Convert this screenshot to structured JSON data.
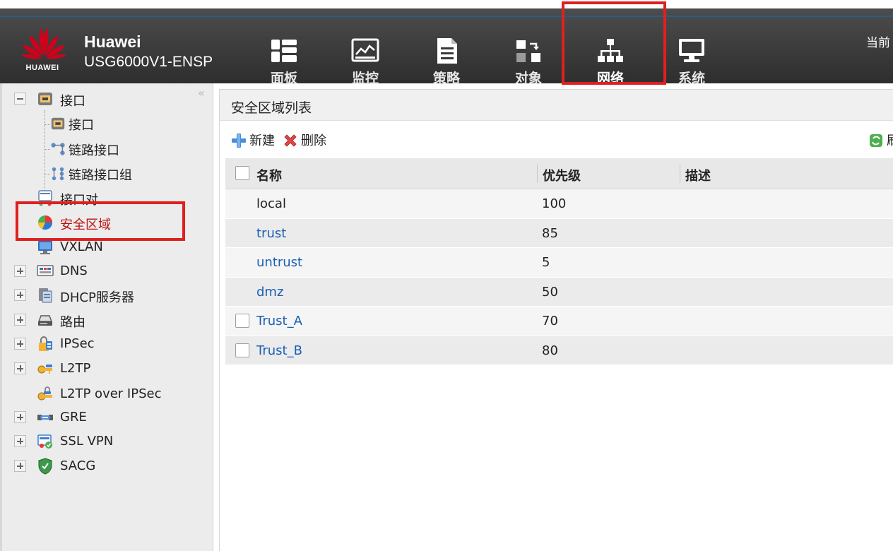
{
  "header": {
    "logo_text": "HUAWEI",
    "brand": "Huawei",
    "model": "USG6000V1-ENSP",
    "current_user_prefix": "当前",
    "nav": [
      {
        "id": "dashboard",
        "label": "面板",
        "icon": "dashboard-icon"
      },
      {
        "id": "monitor",
        "label": "监控",
        "icon": "monitor-icon"
      },
      {
        "id": "policy",
        "label": "策略",
        "icon": "policy-icon"
      },
      {
        "id": "object",
        "label": "对象",
        "icon": "object-icon"
      },
      {
        "id": "network",
        "label": "网络",
        "icon": "network-icon",
        "active": true
      },
      {
        "id": "system",
        "label": "系统",
        "icon": "system-icon"
      }
    ]
  },
  "sidebar": {
    "collapse_glyph": "«",
    "interface_group": {
      "label": "接口",
      "toggle": "minus"
    },
    "interface_children": [
      "接口",
      "链路接口",
      "链路接口组"
    ],
    "items": [
      {
        "label": "接口对"
      },
      {
        "label": "安全区域",
        "active": true
      },
      {
        "label": "VXLAN"
      },
      {
        "label": "DNS",
        "toggle": "plus"
      },
      {
        "label": "DHCP服务器",
        "toggle": "plus"
      },
      {
        "label": "路由",
        "toggle": "plus"
      },
      {
        "label": "IPSec",
        "toggle": "plus"
      },
      {
        "label": "L2TP",
        "toggle": "plus"
      },
      {
        "label": "L2TP over IPSec"
      },
      {
        "label": "GRE",
        "toggle": "plus"
      },
      {
        "label": "SSL VPN",
        "toggle": "plus"
      },
      {
        "label": "SACG",
        "toggle": "plus"
      }
    ]
  },
  "main": {
    "title": "安全区域列表",
    "toolbar": {
      "new_label": "新建",
      "delete_label": "删除",
      "refresh_label": "刷"
    },
    "table": {
      "columns": [
        "名称",
        "优先级",
        "描述"
      ],
      "rows": [
        {
          "name": "local",
          "priority": "100",
          "description": "",
          "selectable": false,
          "link": false
        },
        {
          "name": "trust",
          "priority": "85",
          "description": "",
          "selectable": false,
          "link": true
        },
        {
          "name": "untrust",
          "priority": "5",
          "description": "",
          "selectable": false,
          "link": true
        },
        {
          "name": "dmz",
          "priority": "50",
          "description": "",
          "selectable": false,
          "link": true
        },
        {
          "name": "Trust_A",
          "priority": "70",
          "description": "",
          "selectable": true,
          "link": true
        },
        {
          "name": "Trust_B",
          "priority": "80",
          "description": "",
          "selectable": true,
          "link": true
        }
      ]
    }
  },
  "colors": {
    "highlight": "#e02020",
    "link": "#1a5fb4",
    "header_bg": "#3a3a3a",
    "huawei_red": "#d0021b"
  }
}
